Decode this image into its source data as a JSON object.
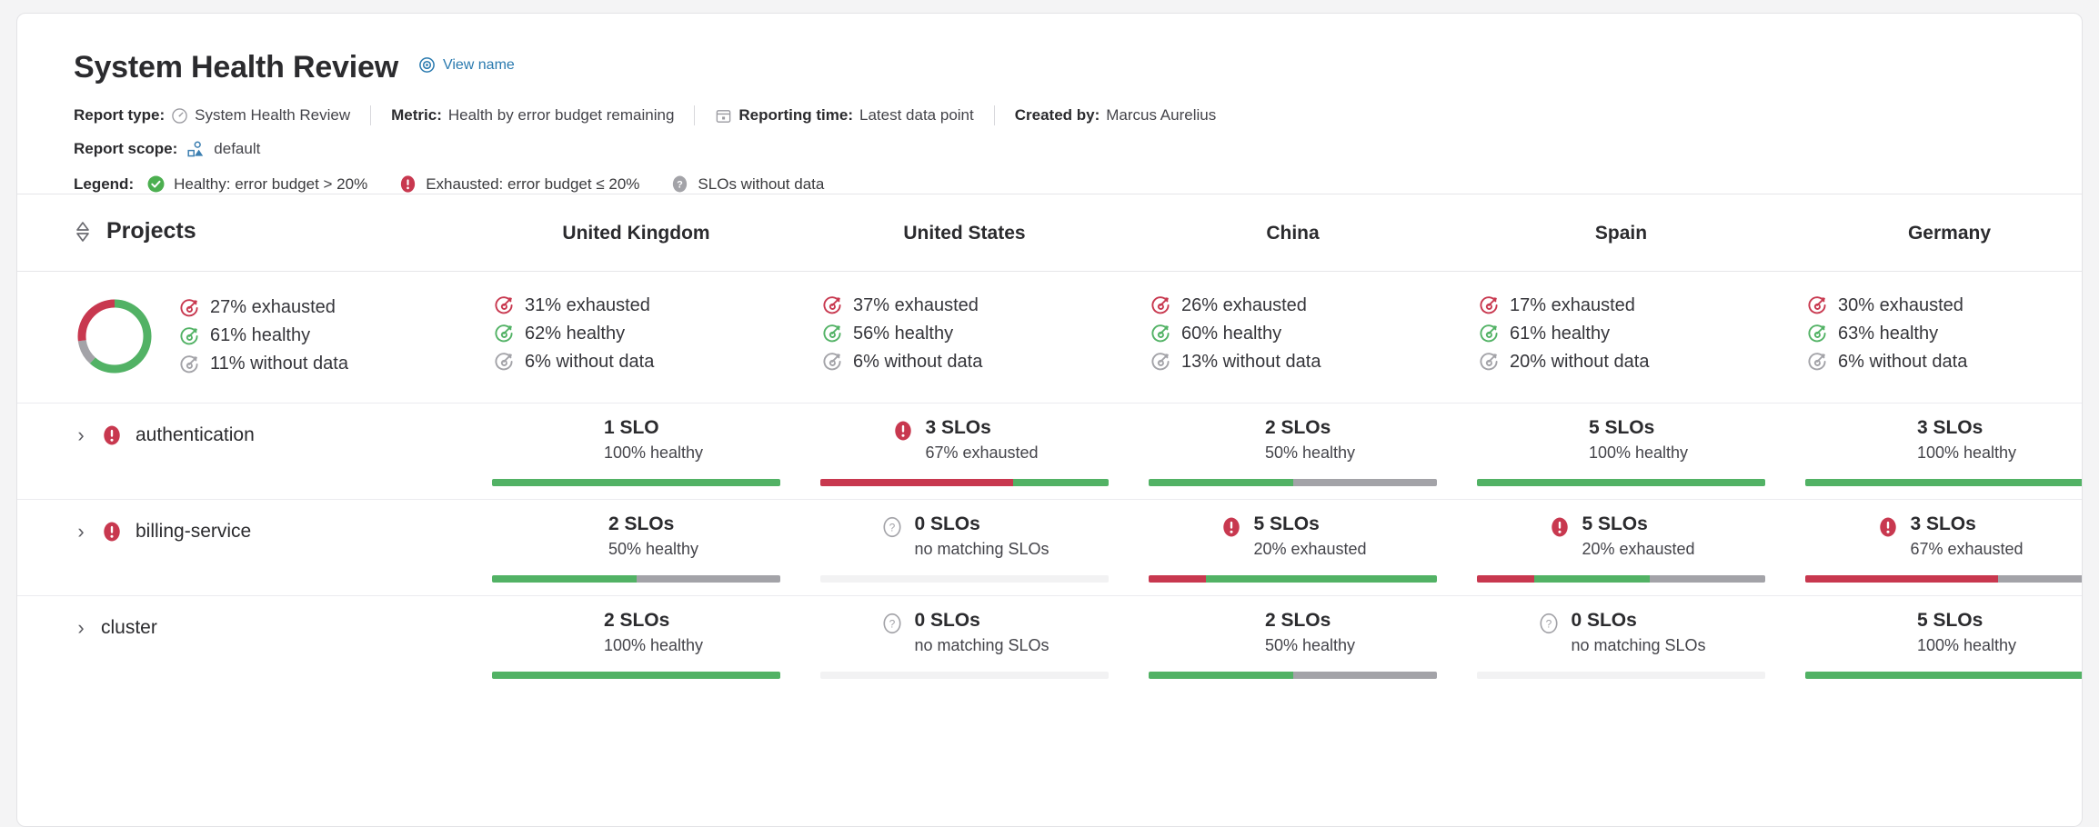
{
  "header": {
    "title": "System Health Review",
    "view_name_link": "View name",
    "meta": [
      {
        "label": "Report type:",
        "value": "System Health Review",
        "icon": "gauge-icon"
      },
      {
        "label": "Metric:",
        "value": "Health by error budget remaining",
        "icon": ""
      },
      {
        "label": "Reporting time:",
        "value": "Latest data point",
        "icon": "calendar-icon"
      },
      {
        "label": "Created by:",
        "value": "Marcus Aurelius",
        "icon": ""
      }
    ],
    "scope": {
      "label": "Report scope:",
      "value": "default",
      "icon": "scope-icon"
    },
    "legend": {
      "label": "Legend:",
      "items": [
        {
          "text": "Healthy: error budget > 20%",
          "status": "healthy"
        },
        {
          "text": "Exhausted: error budget ≤ 20%",
          "status": "exhausted"
        },
        {
          "text": "SLOs without data",
          "status": "nodata"
        }
      ]
    }
  },
  "colors": {
    "healthy": "#52b265",
    "exhausted": "#c8384f",
    "nodata": "#a3a3a8",
    "link": "#2a7aaf",
    "text": "#2b2b2e"
  },
  "table": {
    "projects_header": "Projects",
    "sort_icon": "sort-updown-icon",
    "columns": [
      "United Kingdom",
      "United States",
      "China",
      "Spain",
      "Germany"
    ]
  },
  "summary": {
    "overall": {
      "donut": {
        "exhausted": 27,
        "healthy": 61,
        "nodata": 11
      },
      "stats": [
        {
          "value": "27% exhausted",
          "status": "exhausted"
        },
        {
          "value": "61% healthy",
          "status": "healthy"
        },
        {
          "value": "11% without data",
          "status": "nodata"
        }
      ]
    },
    "columns": [
      {
        "stats": [
          {
            "value": "31% exhausted",
            "status": "exhausted"
          },
          {
            "value": "62% healthy",
            "status": "healthy"
          },
          {
            "value": "6% without data",
            "status": "nodata"
          }
        ]
      },
      {
        "stats": [
          {
            "value": "37% exhausted",
            "status": "exhausted"
          },
          {
            "value": "56% healthy",
            "status": "healthy"
          },
          {
            "value": "6% without data",
            "status": "nodata"
          }
        ]
      },
      {
        "stats": [
          {
            "value": "26% exhausted",
            "status": "exhausted"
          },
          {
            "value": "60% healthy",
            "status": "healthy"
          },
          {
            "value": "13% without data",
            "status": "nodata"
          }
        ]
      },
      {
        "stats": [
          {
            "value": "17% exhausted",
            "status": "exhausted"
          },
          {
            "value": "61% healthy",
            "status": "healthy"
          },
          {
            "value": "20% without data",
            "status": "nodata"
          }
        ]
      },
      {
        "stats": [
          {
            "value": "30% exhausted",
            "status": "exhausted"
          },
          {
            "value": "63% healthy",
            "status": "healthy"
          },
          {
            "value": "6% without data",
            "status": "nodata"
          }
        ]
      }
    ]
  },
  "rows": [
    {
      "name": "authentication",
      "expand_icon": "chevron-right-icon",
      "status_badge": "exhausted",
      "cells": [
        {
          "count": "1 SLO",
          "sub": "100% healthy",
          "icon": "",
          "bar": {
            "exhausted": 0,
            "healthy": 100,
            "nodata": 0
          }
        },
        {
          "count": "3 SLOs",
          "sub": "67% exhausted",
          "icon": "exhausted",
          "bar": {
            "exhausted": 67,
            "healthy": 33,
            "nodata": 0
          }
        },
        {
          "count": "2 SLOs",
          "sub": "50% healthy",
          "icon": "",
          "bar": {
            "exhausted": 0,
            "healthy": 50,
            "nodata": 50
          }
        },
        {
          "count": "5 SLOs",
          "sub": "100% healthy",
          "icon": "",
          "bar": {
            "exhausted": 0,
            "healthy": 100,
            "nodata": 0
          }
        },
        {
          "count": "3 SLOs",
          "sub": "100% healthy",
          "icon": "",
          "bar": {
            "exhausted": 0,
            "healthy": 100,
            "nodata": 0
          }
        }
      ]
    },
    {
      "name": "billing-service",
      "expand_icon": "chevron-right-icon",
      "status_badge": "exhausted",
      "cells": [
        {
          "count": "2 SLOs",
          "sub": "50% healthy",
          "icon": "",
          "bar": {
            "exhausted": 0,
            "healthy": 50,
            "nodata": 50
          }
        },
        {
          "count": "0 SLOs",
          "sub": "no matching SLOs",
          "icon": "nodata",
          "bar": null
        },
        {
          "count": "5 SLOs",
          "sub": "20% exhausted",
          "icon": "exhausted",
          "bar": {
            "exhausted": 20,
            "healthy": 80,
            "nodata": 0
          }
        },
        {
          "count": "5 SLOs",
          "sub": "20% exhausted",
          "icon": "exhausted",
          "bar": {
            "exhausted": 20,
            "healthy": 40,
            "nodata": 40
          }
        },
        {
          "count": "3 SLOs",
          "sub": "67% exhausted",
          "icon": "exhausted",
          "bar": {
            "exhausted": 67,
            "healthy": 0,
            "nodata": 33
          }
        }
      ]
    },
    {
      "name": "cluster",
      "expand_icon": "chevron-right-icon",
      "status_badge": "",
      "cells": [
        {
          "count": "2 SLOs",
          "sub": "100% healthy",
          "icon": "",
          "bar": {
            "exhausted": 0,
            "healthy": 100,
            "nodata": 0
          }
        },
        {
          "count": "0 SLOs",
          "sub": "no matching SLOs",
          "icon": "nodata",
          "bar": null
        },
        {
          "count": "2 SLOs",
          "sub": "50% healthy",
          "icon": "",
          "bar": {
            "exhausted": 0,
            "healthy": 50,
            "nodata": 50
          }
        },
        {
          "count": "0 SLOs",
          "sub": "no matching SLOs",
          "icon": "nodata",
          "bar": null
        },
        {
          "count": "5 SLOs",
          "sub": "100% healthy",
          "icon": "",
          "bar": {
            "exhausted": 0,
            "healthy": 100,
            "nodata": 0
          }
        }
      ]
    }
  ]
}
